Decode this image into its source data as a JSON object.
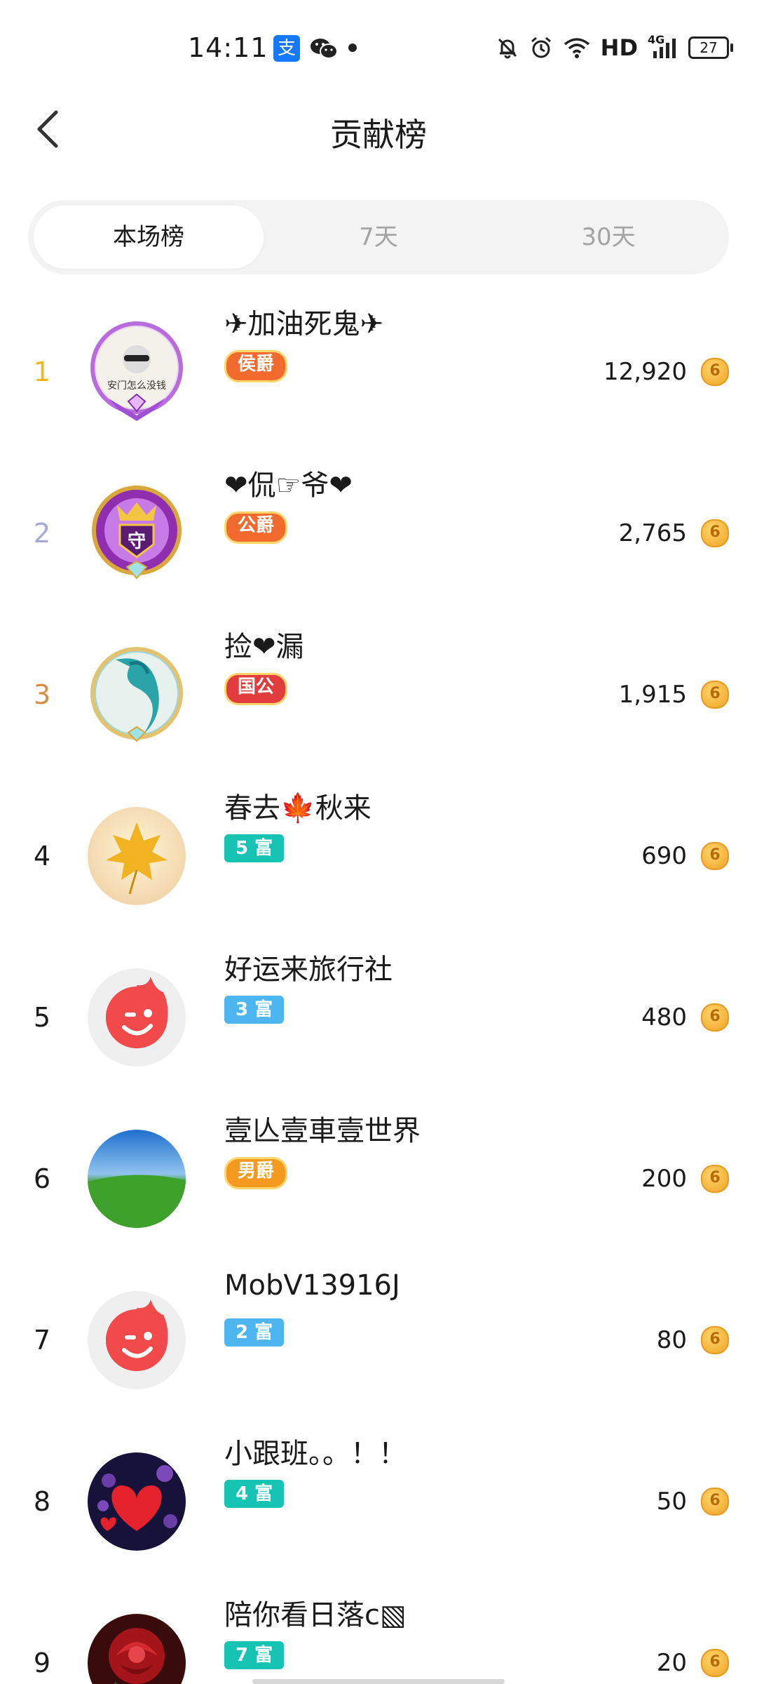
{
  "status_bar": {
    "time": "14:11",
    "alipay_glyph": "支",
    "network": "HD",
    "signal_label": "4G",
    "battery": "27"
  },
  "header": {
    "title": "贡献榜"
  },
  "tabs": [
    {
      "label": "本场榜",
      "active": true
    },
    {
      "label": "7天",
      "active": false
    },
    {
      "label": "30天",
      "active": false
    }
  ],
  "colors": {
    "rank1": "#f5b61f",
    "rank2": "#a7a9d8",
    "rank3": "#d58e43",
    "rank_default": "#1a1a1a",
    "badge_teal": "#17c3b2",
    "badge_blue": "#4db5f0",
    "badge_noble_orange": "#f26a2e",
    "badge_noble_red": "#e23c3c",
    "badge_noble_gold": "#f59a1f"
  },
  "leaderboard": [
    {
      "rank": "1",
      "name": "✈加油死鬼✈",
      "badge": "侯爵",
      "badge_type": "noble_orange",
      "score": "12,920",
      "avatar": "avatar-guard-purple"
    },
    {
      "rank": "2",
      "name": "❤侃☞爷❤",
      "badge": "公爵",
      "badge_type": "noble_orange",
      "score": "2,765",
      "avatar": "avatar-guard-crown"
    },
    {
      "rank": "3",
      "name": "捡❤漏",
      "badge": "国公",
      "badge_type": "noble_red",
      "score": "1,915",
      "avatar": "avatar-dragon"
    },
    {
      "rank": "4",
      "name": "春去🍁秋来",
      "badge": "5 富",
      "badge_type": "teal",
      "score": "690",
      "avatar": "avatar-leaf"
    },
    {
      "rank": "5",
      "name": "好运来旅行社",
      "badge": "3 富",
      "badge_type": "blue",
      "score": "480",
      "avatar": "avatar-default-wink"
    },
    {
      "rank": "6",
      "name": "壹亾壹車壹世界",
      "badge": "男爵",
      "badge_type": "noble_gold",
      "score": "200",
      "avatar": "avatar-green-hills"
    },
    {
      "rank": "7",
      "name": "MobV13916J",
      "badge": "2 富",
      "badge_type": "blue",
      "score": "80",
      "avatar": "avatar-default-wink"
    },
    {
      "rank": "8",
      "name": "小跟班。。！！",
      "badge": "4 富",
      "badge_type": "teal",
      "score": "50",
      "avatar": "avatar-hearts"
    },
    {
      "rank": "9",
      "name": "陪你看日落c▧",
      "badge": "7 富",
      "badge_type": "teal",
      "score": "20",
      "avatar": "avatar-rose"
    }
  ]
}
